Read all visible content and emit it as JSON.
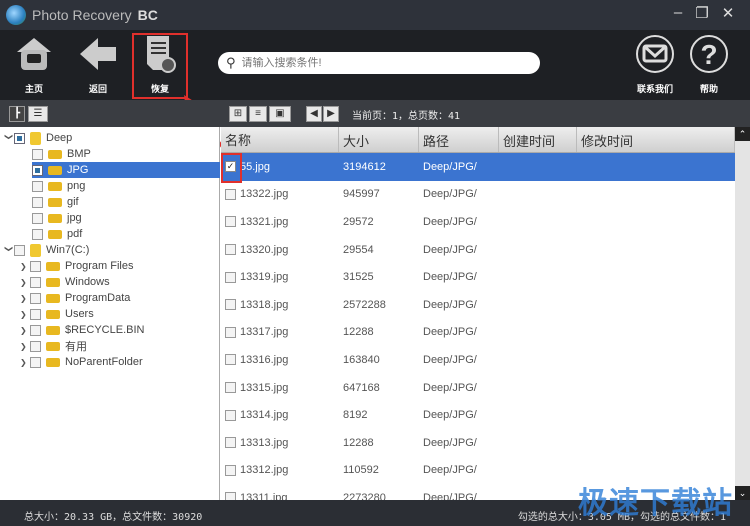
{
  "app": {
    "title": "Photo Recovery",
    "title_suffix": "BC"
  },
  "window_controls": {
    "minimize": "–",
    "restore": "❐",
    "close": "✕"
  },
  "toolbar": {
    "home": "主页",
    "back": "返回",
    "recover": "恢复",
    "contact": "联系我们",
    "help": "帮助"
  },
  "search": {
    "placeholder": "请输入搜索条件!"
  },
  "subbar": {
    "page_info": "当前页：1，总页数：41"
  },
  "tree": [
    {
      "label": "Deep",
      "level": 0,
      "expanded": true,
      "check": "partial",
      "type": "drive"
    },
    {
      "label": "BMP",
      "level": 1,
      "check": "none",
      "type": "folder"
    },
    {
      "label": "JPG",
      "level": 1,
      "check": "partial",
      "type": "folder",
      "selected": true
    },
    {
      "label": "png",
      "level": 1,
      "check": "none",
      "type": "folder"
    },
    {
      "label": "gif",
      "level": 1,
      "check": "none",
      "type": "folder"
    },
    {
      "label": "jpg",
      "level": 1,
      "check": "none",
      "type": "folder"
    },
    {
      "label": "pdf",
      "level": 1,
      "check": "none",
      "type": "folder"
    },
    {
      "label": "Win7(C:)",
      "level": 0,
      "expanded": true,
      "check": "none",
      "type": "drive"
    },
    {
      "label": "Program Files",
      "level": 1,
      "check": "none",
      "type": "folder",
      "arrow": true
    },
    {
      "label": "Windows",
      "level": 1,
      "check": "none",
      "type": "folder",
      "arrow": true
    },
    {
      "label": "ProgramData",
      "level": 1,
      "check": "none",
      "type": "folder",
      "arrow": true
    },
    {
      "label": "Users",
      "level": 1,
      "check": "none",
      "type": "folder",
      "arrow": true
    },
    {
      "label": "$RECYCLE.BIN",
      "level": 1,
      "check": "none",
      "type": "folder",
      "arrow": true
    },
    {
      "label": "有用",
      "level": 1,
      "check": "none",
      "type": "folder",
      "arrow": true
    },
    {
      "label": "NoParentFolder",
      "level": 1,
      "check": "none",
      "type": "folder",
      "arrow": true
    }
  ],
  "table": {
    "columns": [
      "名称",
      "大小",
      "路径",
      "创建时间",
      "修改时间"
    ],
    "rows": [
      {
        "name": "55.jpg",
        "size": "3194612",
        "path": "Deep/JPG/",
        "checked": true,
        "selected": true
      },
      {
        "name": "13322.jpg",
        "size": "945997",
        "path": "Deep/JPG/"
      },
      {
        "name": "13321.jpg",
        "size": "29572",
        "path": "Deep/JPG/"
      },
      {
        "name": "13320.jpg",
        "size": "29554",
        "path": "Deep/JPG/"
      },
      {
        "name": "13319.jpg",
        "size": "31525",
        "path": "Deep/JPG/"
      },
      {
        "name": "13318.jpg",
        "size": "2572288",
        "path": "Deep/JPG/"
      },
      {
        "name": "13317.jpg",
        "size": "12288",
        "path": "Deep/JPG/"
      },
      {
        "name": "13316.jpg",
        "size": "163840",
        "path": "Deep/JPG/"
      },
      {
        "name": "13315.jpg",
        "size": "647168",
        "path": "Deep/JPG/"
      },
      {
        "name": "13314.jpg",
        "size": "8192",
        "path": "Deep/JPG/"
      },
      {
        "name": "13313.jpg",
        "size": "12288",
        "path": "Deep/JPG/"
      },
      {
        "name": "13312.jpg",
        "size": "110592",
        "path": "Deep/JPG/"
      },
      {
        "name": "13311.jpg",
        "size": "2273280",
        "path": "Deep/JPG/"
      }
    ]
  },
  "status": {
    "left": "总大小：20.33 GB，总文件数：30920",
    "right": "勾选的总大小：3.05 MB，勾选的总文件数：1"
  },
  "watermark": "极速下载站",
  "colors": {
    "selection": "#3b74d0",
    "highlight": "#e0302c",
    "titlebar": "#2e323a"
  }
}
